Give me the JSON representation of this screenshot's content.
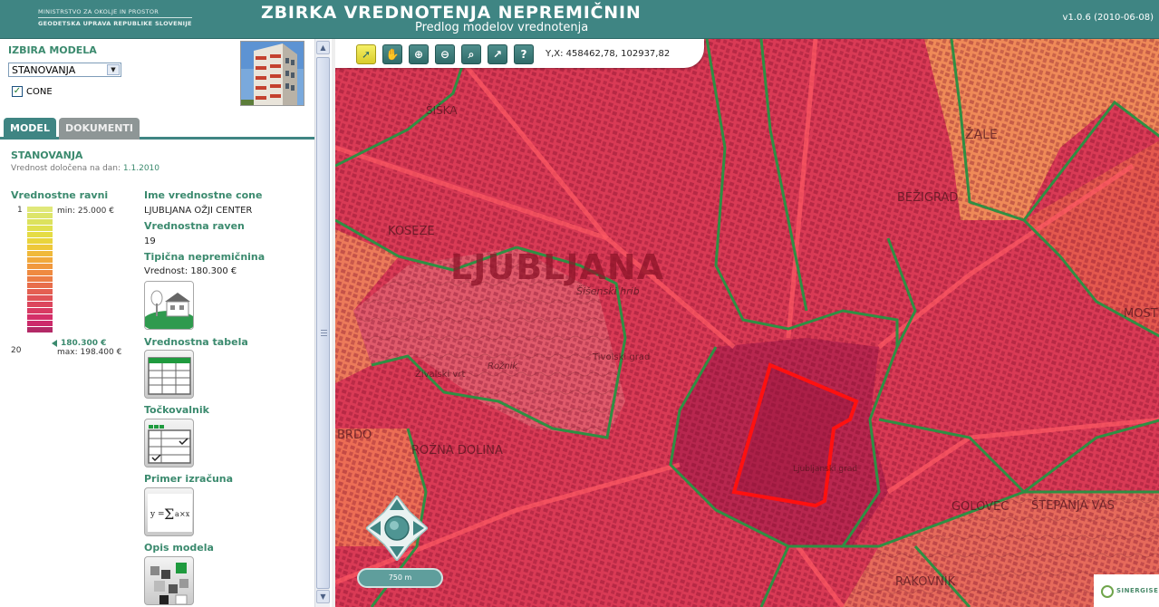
{
  "header": {
    "ministry_line1": "MINISTRSTVO ZA OKOLJE IN PROSTOR",
    "ministry_line2": "GEODETSKA UPRAVA REPUBLIKE SLOVENIJE",
    "title": "ZBIRKA VREDNOTENJA NEPREMIČNIN",
    "subtitle": "Predlog modelov vrednotenja",
    "version": "v1.0.6 (2010-06-08)"
  },
  "model_selector": {
    "label": "IZBIRA MODELA",
    "selected": "STANOVANJA",
    "cone_checked": true,
    "cone_label": "CONE"
  },
  "tabs": [
    {
      "label": "MODEL",
      "active": true
    },
    {
      "label": "DOKUMENTI",
      "active": false
    }
  ],
  "model": {
    "title": "STANOVANJA",
    "date_label": "Vrednost določena na dan:",
    "date_value": "1.1.2010",
    "levels_label": "Vrednostne ravni",
    "level_min_num": "1",
    "level_max_num": "20",
    "min_price": "min: 25.000 €",
    "current_price": "180.300 €",
    "max_price": "max: 198.400 €",
    "scale_colors": [
      "#e0e87a",
      "#dde56a",
      "#dce25d",
      "#e0e04f",
      "#e5dc45",
      "#e9d43c",
      "#eec83a",
      "#f0b93a",
      "#f1a93b",
      "#f1993d",
      "#ef8a40",
      "#ec7d45",
      "#e86e4b",
      "#e45f51",
      "#e05357",
      "#dc465d",
      "#d83a63",
      "#d42f69",
      "#cc2a6a",
      "#b32966"
    ],
    "current_level": 19
  },
  "zone_info": {
    "zone_name_label": "Ime vrednostne cone",
    "zone_name": "LJUBLJANA OŽJI CENTER",
    "level_label": "Vrednostna raven",
    "level_value": "19",
    "typical_label": "Tipična nepremičnina",
    "typical_value": "Vrednost: 180.300 €",
    "table_label": "Vrednostna tabela",
    "points_label": "Točkovalnik",
    "example_label": "Primer izračuna",
    "description_label": "Opis modela"
  },
  "map": {
    "coordinates": "Y,X: 458462,78, 102937,82",
    "scale": "750 m",
    "attribution": "SINERGISE",
    "places": {
      "ljubljana": "LJUBLJANA",
      "koseze": "KOSEZE",
      "bezigrad": "BEŽIGRAD",
      "zale": "ŽALE",
      "moste": "MOSTE",
      "siska": "ŠIŠKA",
      "rozna_dolina": "ROŽNA DOLINA",
      "golovec": "GOLOVEC",
      "rakovnik": "RAKOVNIK",
      "stepanja_vas": "ŠTEPANJA VAS",
      "sisenski_hrib": "Šišenski hrib",
      "tivolski_grad": "Tivolski grad",
      "zivalski_vrt": "Živalski vrt",
      "roznik": "Rožnik",
      "ljubljanski_grad": "Ljubljanski grad",
      "brdo": "BRDO"
    },
    "tool_icons": [
      "select-tool",
      "pan-tool",
      "zoom-in-tool",
      "zoom-out-tool",
      "zoom-extent-tool",
      "measure-tool",
      "help-tool"
    ],
    "colors": {
      "zone_high": "#d93a55",
      "zone_mid": "#e85d52",
      "zone_low": "#ef8a58",
      "boundary": "#2f8f43",
      "selected_boundary": "#ff1010"
    }
  }
}
